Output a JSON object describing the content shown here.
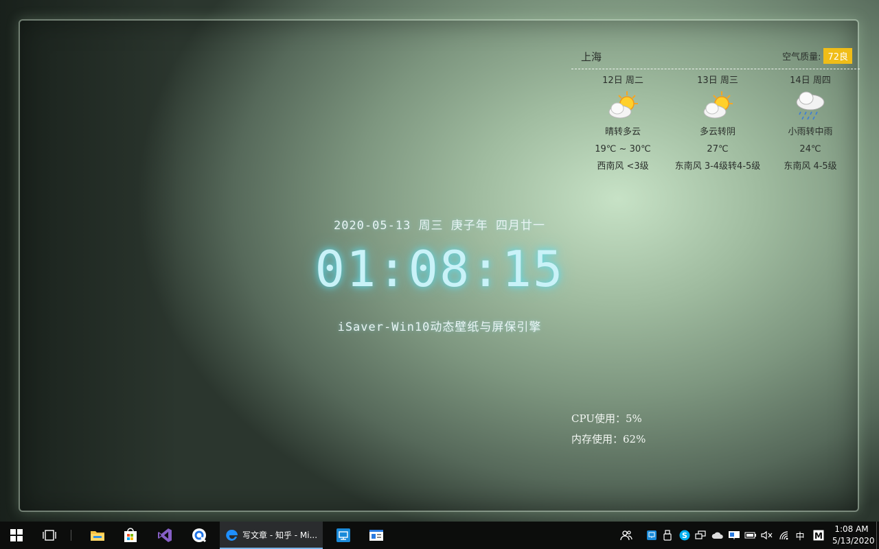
{
  "weather": {
    "city": "上海",
    "air_quality_label": "空气质量:",
    "air_quality_value": "72良",
    "days": [
      {
        "date": "12日 周二",
        "icon": "partly-cloudy-sun-icon",
        "condition": "晴转多云",
        "temp": "19℃ ~ 30℃",
        "wind": "西南风  <3级"
      },
      {
        "date": "13日 周三",
        "icon": "partly-cloudy-sun-icon",
        "condition": "多云转阴",
        "temp": "27℃",
        "wind": "东南风  3-4级转4-5级"
      },
      {
        "date": "14日 周四",
        "icon": "rain-cloud-icon",
        "condition": "小雨转中雨",
        "temp": "24℃",
        "wind": "东南风  4-5级"
      }
    ]
  },
  "clock": {
    "date": "2020-05-13 周三 庚子年 四月廿一",
    "time": "01:08:15",
    "subtitle": "iSaver-Win10动态壁纸与屏保引擎"
  },
  "system": {
    "cpu": "CPU使用：5%",
    "memory": "内存使用：62%"
  },
  "taskbar": {
    "items": [
      "windows-start-icon",
      "task-view-icon",
      "file-explorer-icon",
      "microsoft-store-icon",
      "visual-studio-icon",
      "qq-browser-icon",
      "edge-icon",
      "remote-desktop-icon",
      "app-window-icon"
    ],
    "active_window_title": "写文章 - 知乎 - Mi...",
    "tray": {
      "ime": "中",
      "time": "1:08 AM",
      "date": "5/13/2020"
    }
  },
  "colors": {
    "clock_glow": "#5adcf0",
    "air_quality_badge": "#f0bd18",
    "taskbar": "#0c0d0c"
  }
}
